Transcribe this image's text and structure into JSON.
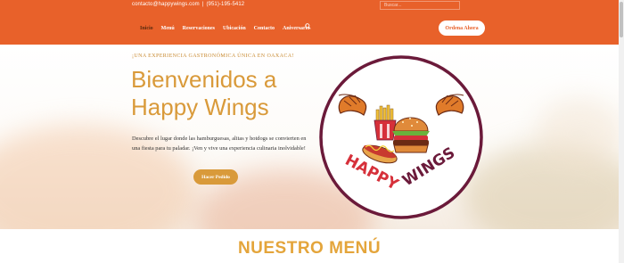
{
  "topbar": {
    "email": "contacto@happywings.com",
    "separator": "|",
    "phone": "(951)-195-5412",
    "search_placeholder": "Buscar..."
  },
  "nav": {
    "items": [
      "Inicio",
      "Menú",
      "Reservaciones",
      "Ubicación",
      "Contacto",
      "Aniversario"
    ],
    "active_index": 0,
    "order_button": "Ordena Ahora"
  },
  "hero": {
    "eyebrow": "¡UNA EXPERIENCIA GASTRONÓMICA ÚNICA EN OAXACA!",
    "title_line1": "Bienvenidos a",
    "title_line2": "Happy Wings",
    "description": "Descubre el lugar donde las hamburguesas, alitas y hotdogs se convierten en una fiesta para tu paladar. ¡Ven y vive una experiencia culinaria inolvidable!",
    "cta": "Hacer Pedido"
  },
  "logo": {
    "word1": "HAPPY",
    "word2": "WINGS"
  },
  "section": {
    "title": "NUESTRO MENÚ"
  },
  "colors": {
    "orange": "#e8612a",
    "gold": "#d99a3a",
    "maroon": "#6b1a3a",
    "red": "#d6303a"
  }
}
